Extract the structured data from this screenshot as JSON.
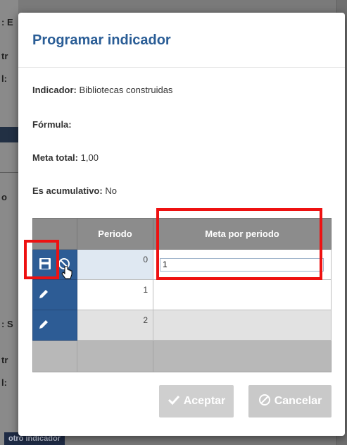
{
  "modal": {
    "title": "Programar indicador",
    "fields": {
      "indicador_label": "Indicador:",
      "indicador_value": "Bibliotecas construidas",
      "formula_label": "Fórmula:",
      "formula_value": "",
      "meta_total_label": "Meta total:",
      "meta_total_value": "1,00",
      "acumulativo_label": "Es acumulativo:",
      "acumulativo_value": "No"
    },
    "table": {
      "columns": [
        "",
        "Periodo",
        "Meta por periodo"
      ],
      "rows": [
        {
          "periodo": "0",
          "meta": "1"
        },
        {
          "periodo": "1",
          "meta": ""
        },
        {
          "periodo": "2",
          "meta": ""
        }
      ]
    },
    "buttons": {
      "accept": "Aceptar",
      "cancel": "Cancelar"
    }
  },
  "background": {
    "bottom_button": "otro indicador"
  },
  "colors": {
    "title": "#2a5d96",
    "action_cell": "#2d5c95",
    "header": "#8c8c8c",
    "annotation": "#ee1111"
  }
}
